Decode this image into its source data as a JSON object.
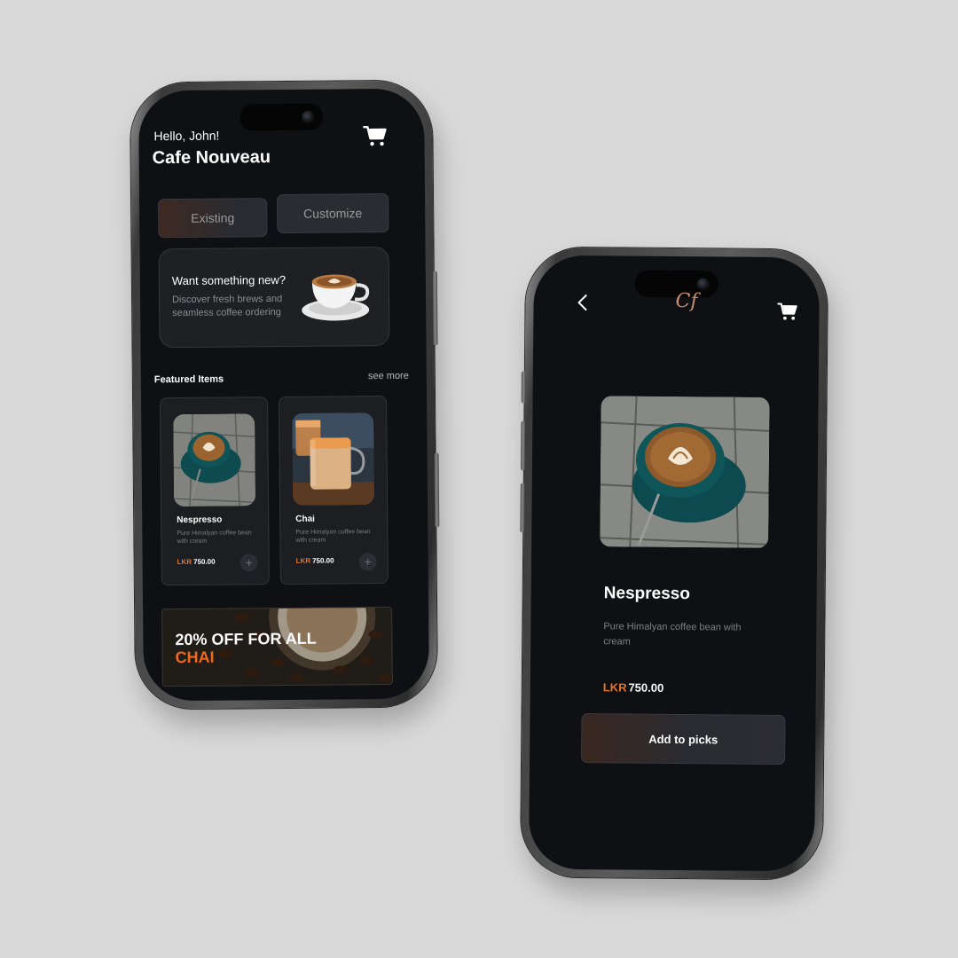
{
  "home": {
    "greeting": "Hello, John!",
    "brand": "Cafe Nouveau",
    "segments": {
      "existing": "Existing",
      "customize": "Customize"
    },
    "promo": {
      "title": "Want something new?",
      "text": "Discover fresh brews and seamless coffee ordering"
    },
    "featured": {
      "title": "Featured Items",
      "see_more": "see more",
      "items": [
        {
          "name": "Nespresso",
          "desc": "Pure Himalyan coffee bean with cream",
          "currency": "LKR",
          "price": "750.00",
          "add": "+"
        },
        {
          "name": "Chai",
          "desc": "Pure Himalyan coffee bean with cream",
          "currency": "LKR",
          "price": "750.00",
          "add": "+"
        }
      ]
    },
    "banner": {
      "line1": "20% OFF FOR ALL",
      "line2": "CHAI"
    }
  },
  "detail": {
    "logo": "Cf",
    "name": "Nespresso",
    "desc": "Pure Himalyan coffee bean with cream",
    "currency": "LKR",
    "price": "750.00",
    "button": "Add to picks"
  },
  "colors": {
    "accent": "#e8742a",
    "background": "#d9d9d9",
    "screen": "#0f1014"
  },
  "icons": [
    "cart-icon",
    "back-icon",
    "add-icon"
  ]
}
